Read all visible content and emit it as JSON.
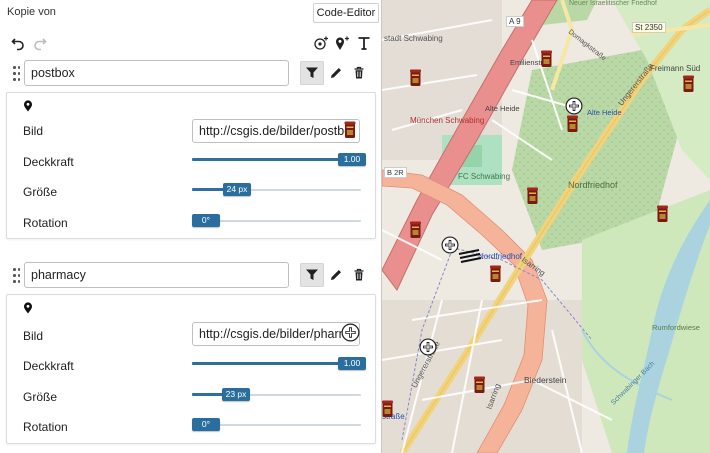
{
  "header": {
    "title": "Kopie von",
    "code_editor_label": "Code-Editor"
  },
  "toolbar": {
    "undo_icon": "undo-icon",
    "redo_icon": "redo-icon",
    "point_icon": "add-point-icon",
    "marker_icon": "add-marker-icon",
    "text_icon": "add-text-icon"
  },
  "labels": {
    "image": "Bild",
    "opacity": "Deckkraft",
    "size": "Größe",
    "rotation": "Rotation"
  },
  "rules": [
    {
      "name": "postbox",
      "image_url": "http://csgis.de/bilder/postbox",
      "opacity": {
        "value": 1.0,
        "label": "1.00"
      },
      "size": {
        "fraction": 0.2,
        "label": "24 px"
      },
      "rotation": {
        "fraction": 0.0,
        "label": "0°"
      }
    },
    {
      "name": "pharmacy",
      "image_url": "http://csgis.de/bilder/pharmacy",
      "opacity": {
        "value": 1.0,
        "label": "1.00"
      },
      "size": {
        "fraction": 0.2,
        "label": "23 px"
      },
      "rotation": {
        "fraction": 0.0,
        "label": "0°"
      }
    }
  ],
  "map": {
    "street_labels": {
      "a9": "A 9",
      "st2350": "St 2350",
      "israel_cemetery": "Neuer Israelitischer Friedhof",
      "domagkstr": "Domagkstraße",
      "emilienstr": "Emilienstr.",
      "ungererstr": "Ungererstraße",
      "alte_heide": "Alte Heide",
      "freimann_sued": "Freimann Süd",
      "muenchen_schwabing": "München Schwabing",
      "fc_schwabing": "FC Schwabing",
      "nordfriedhof": "Nordfriedhof",
      "b2r": "B 2R",
      "nordfriedhof_station": "Nordfriedhof",
      "isarring": "Isarring",
      "biederstein": "Biederstein",
      "rumfordwiese": "Rumfordwiese",
      "strasse": "straße",
      "stadt_schwabing": "stadt Schwabing",
      "schwabinger": "Schwabinger Bach",
      "alte_heide_station": "Alte Heide"
    },
    "colors": {
      "motorway": "#e9908f",
      "primary": "#f3d37a",
      "trunk": "#f5a98a",
      "park": "#cde8b5",
      "cemetery": "#add19e",
      "river": "#aad3df",
      "background": "#f0ebe3"
    }
  }
}
